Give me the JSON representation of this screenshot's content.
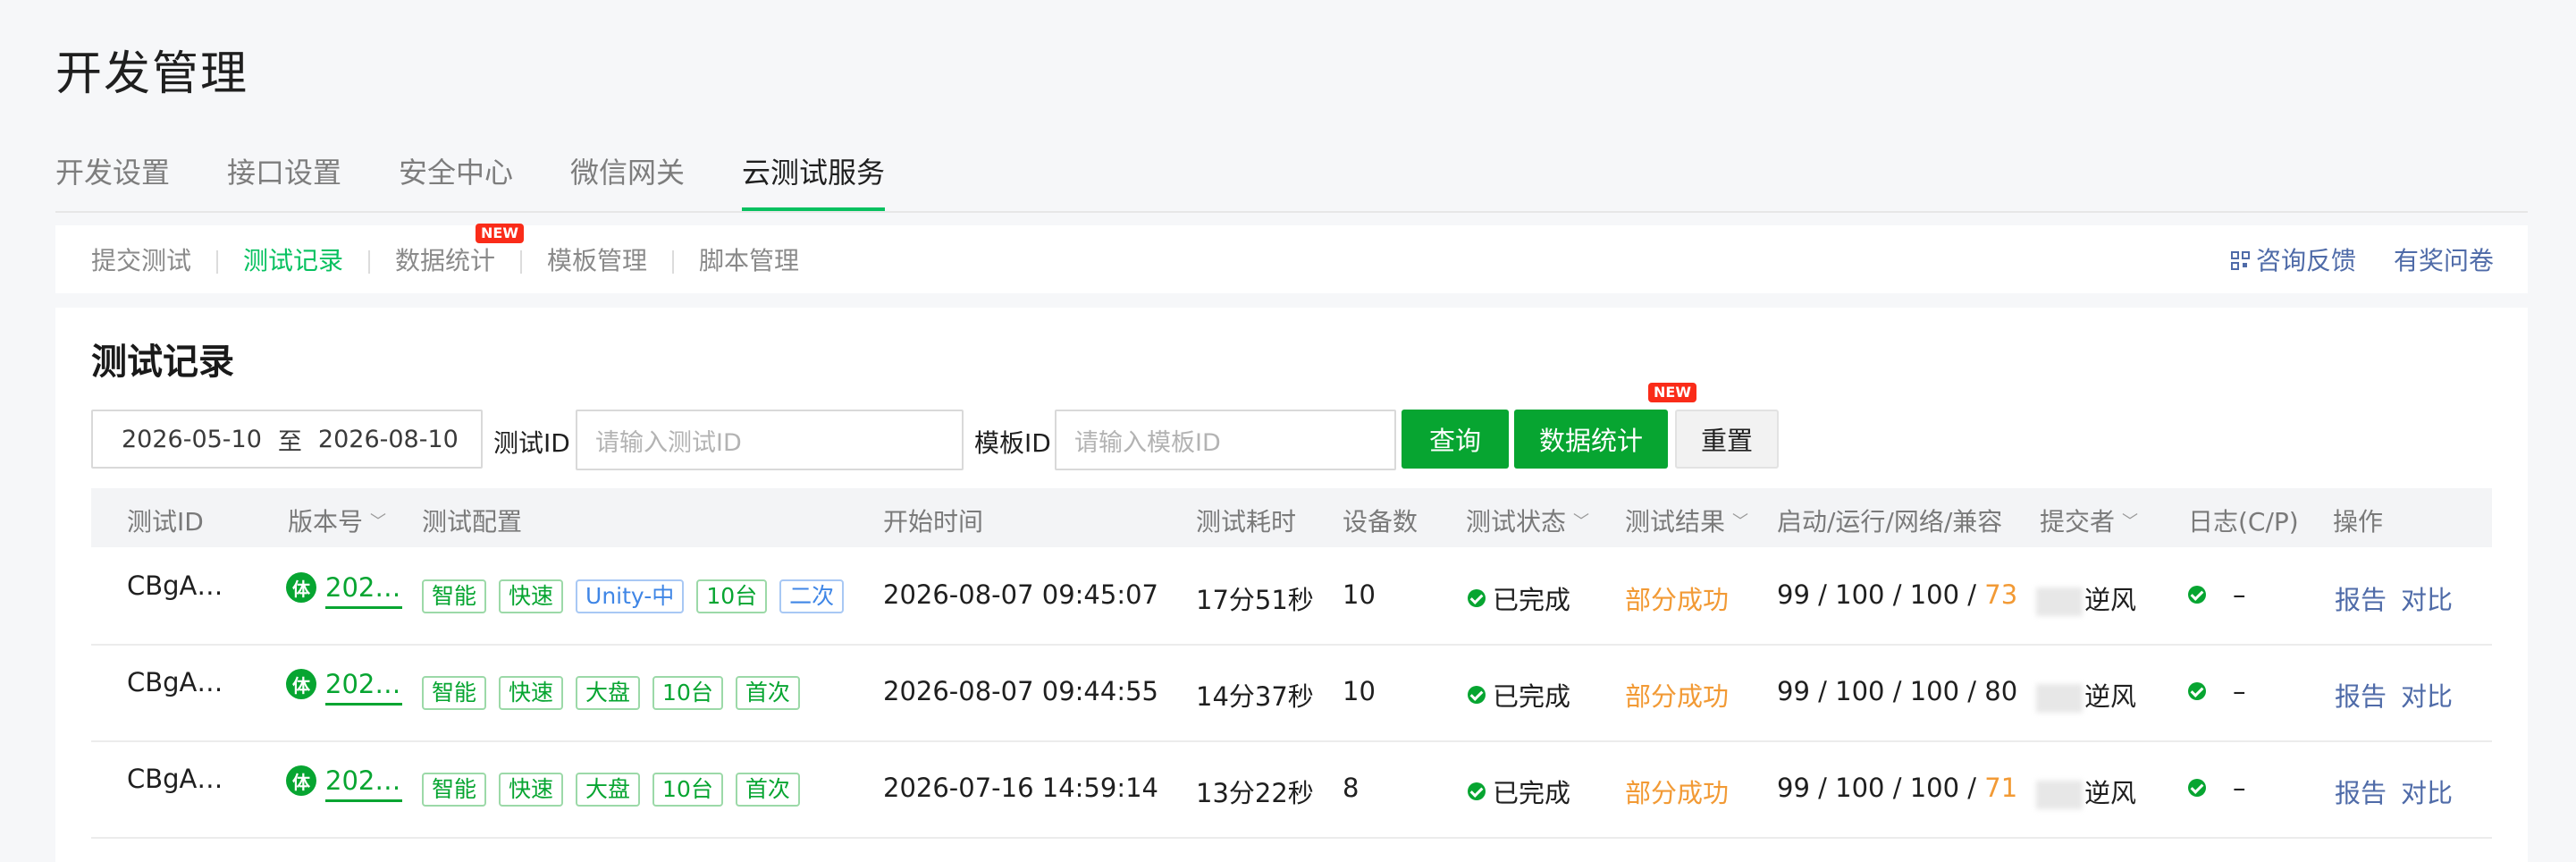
{
  "page_title": "开发管理",
  "main_tabs": [
    "开发设置",
    "接口设置",
    "安全中心",
    "微信网关",
    "云测试服务"
  ],
  "sub_nav": {
    "items": [
      "提交测试",
      "测试记录",
      "数据统计",
      "模板管理",
      "脚本管理"
    ],
    "new_badge": "NEW",
    "consult": "咨询反馈",
    "survey": "有奖问卷"
  },
  "panel": {
    "title": "测试记录",
    "date_start": "2026-05-10",
    "date_sep": "至",
    "date_end": "2026-08-10",
    "test_id_label": "测试ID",
    "test_id_placeholder": "请输入测试ID",
    "template_id_label": "模板ID",
    "template_id_placeholder": "请输入模板ID",
    "btn_query": "查询",
    "btn_stats": "数据统计",
    "btn_stats_badge": "NEW",
    "btn_reset": "重置"
  },
  "table": {
    "headers": [
      "测试ID",
      "版本号",
      "测试配置",
      "开始时间",
      "测试耗时",
      "设备数",
      "测试状态",
      "测试结果",
      "启动/运行/网络/兼容",
      "提交者",
      "日志(C/P)",
      "操作"
    ],
    "rows": [
      {
        "id": "CBgA…",
        "ver_icon": "体",
        "ver": "202…",
        "tags": [
          "智能",
          "快速",
          "Unity-中",
          "10台",
          "二次"
        ],
        "start": "2026-08-07 09:45:07",
        "duration": "17分51秒",
        "devices": "10",
        "status": "已完成",
        "result": "部分成功",
        "s1": "99",
        "s2": "100",
        "s3": "100",
        "s4": "73",
        "submitter": "逆风",
        "log": "–",
        "op1": "报告",
        "op2": "对比"
      },
      {
        "id": "CBgA…",
        "ver_icon": "体",
        "ver": "202…",
        "tags": [
          "智能",
          "快速",
          "大盘",
          "10台",
          "首次"
        ],
        "start": "2026-08-07 09:44:55",
        "duration": "14分37秒",
        "devices": "10",
        "status": "已完成",
        "result": "部分成功",
        "s1": "99",
        "s2": "100",
        "s3": "100",
        "s4": "80",
        "submitter": "逆风",
        "log": "–",
        "op1": "报告",
        "op2": "对比"
      },
      {
        "id": "CBgA…",
        "ver_icon": "体",
        "ver": "202…",
        "tags": [
          "智能",
          "快速",
          "大盘",
          "10台",
          "首次"
        ],
        "start": "2026-07-16 14:59:14",
        "duration": "13分22秒",
        "devices": "8",
        "status": "已完成",
        "result": "部分成功",
        "s1": "99",
        "s2": "100",
        "s3": "100",
        "s4": "71",
        "submitter": "逆风",
        "log": "–",
        "op1": "报告",
        "op2": "对比"
      }
    ]
  },
  "colors": {
    "accent": "#07c160",
    "primary_btn": "#07a531",
    "link": "#4f6ba8",
    "warn": "#f29a35",
    "badge": "#fa2c19"
  }
}
